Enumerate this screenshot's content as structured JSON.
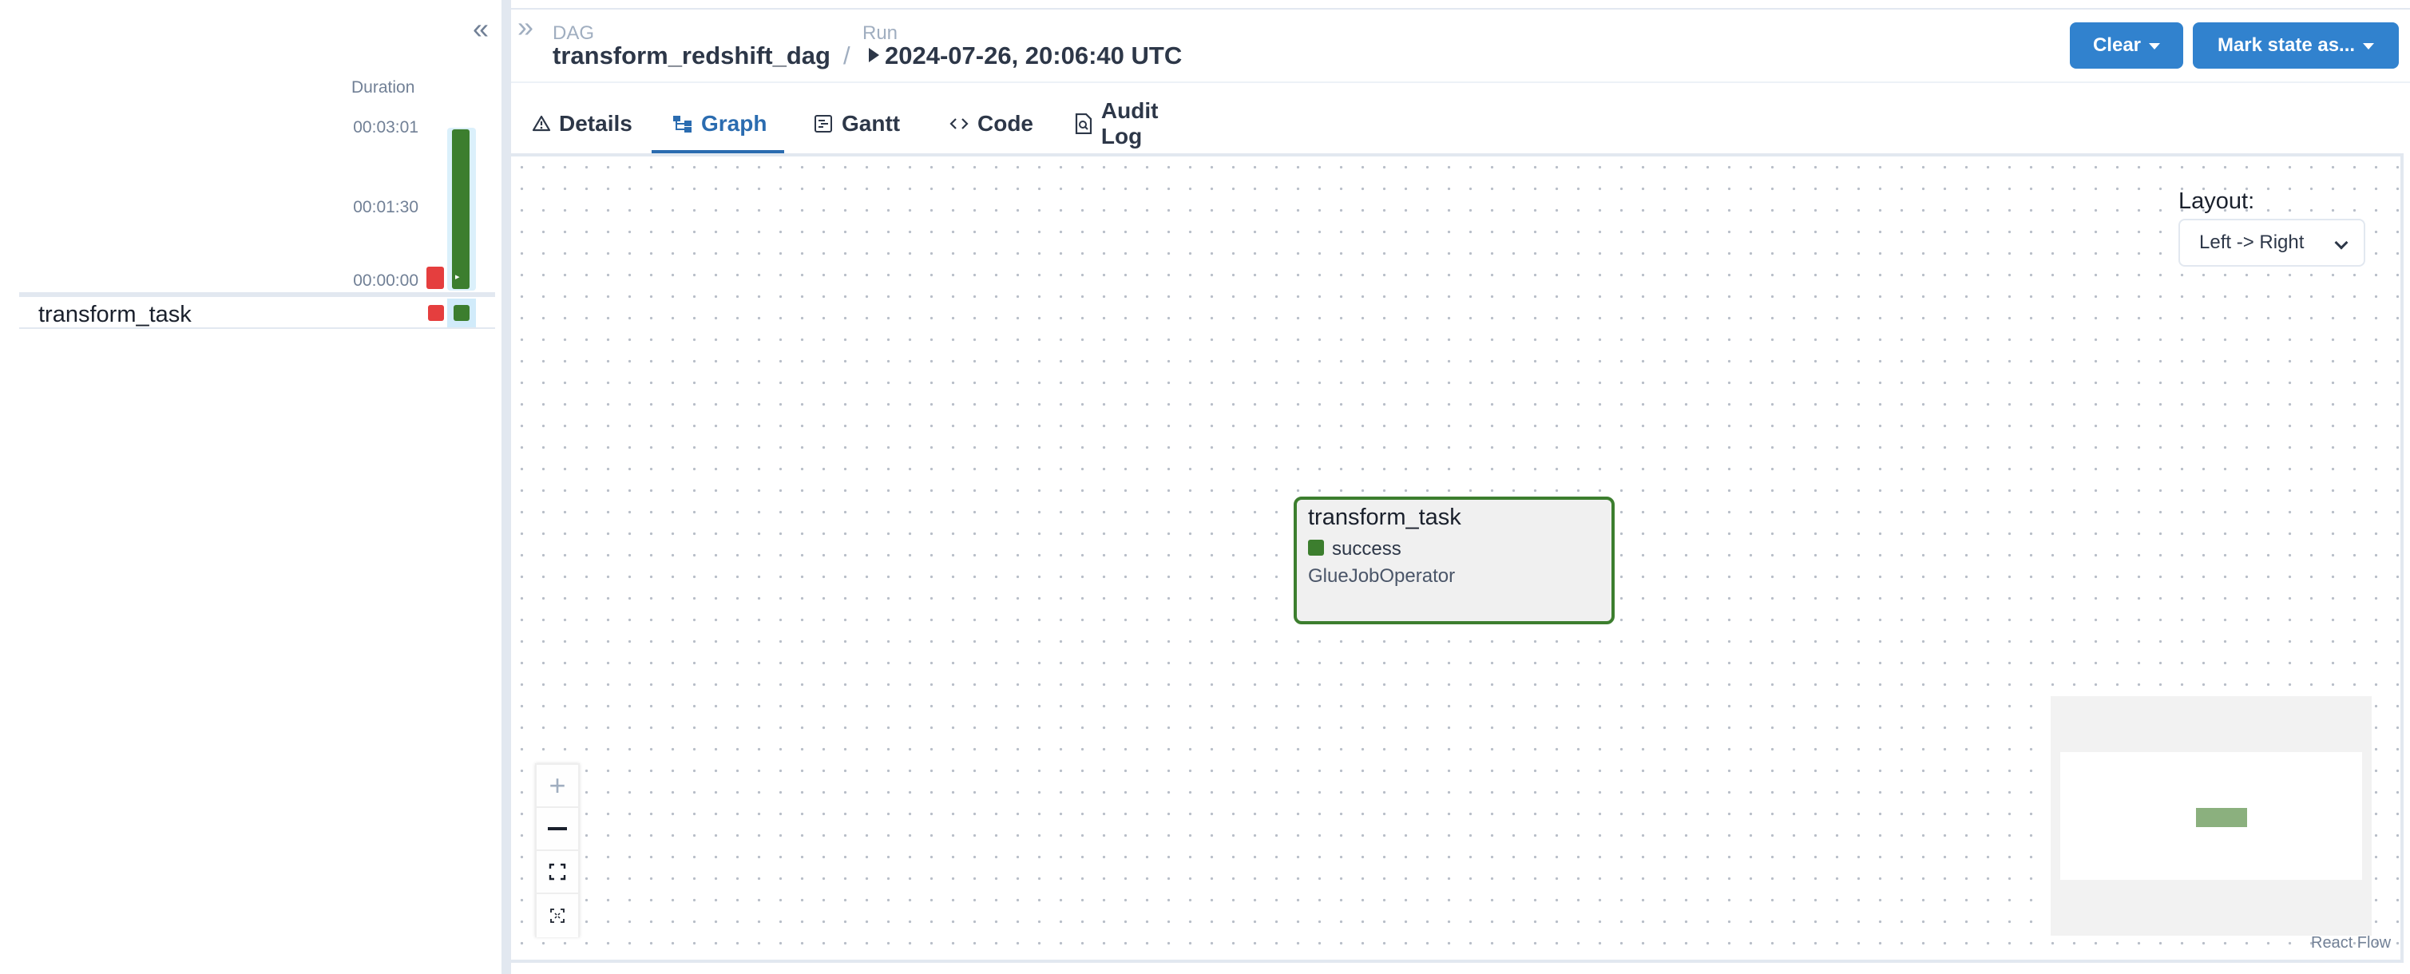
{
  "grid": {
    "duration_label": "Duration",
    "ticks": [
      "00:03:01",
      "00:01:30",
      "00:00:00"
    ],
    "run": {
      "state": "success",
      "duration": "00:03:01"
    },
    "tasks": [
      {
        "name": "transform_task",
        "state": "success"
      }
    ]
  },
  "header": {
    "dag_label": "DAG",
    "dag_id": "transform_redshift_dag",
    "separator": "/",
    "run_label": "Run",
    "run_value": "2024-07-26, 20:06:40 UTC",
    "clear_label": "Clear",
    "mark_state_label": "Mark state as..."
  },
  "tabs": [
    {
      "label": "Details",
      "icon": "alert-triangle-icon",
      "active": false
    },
    {
      "label": "Graph",
      "icon": "graph-icon",
      "active": true
    },
    {
      "label": "Gantt",
      "icon": "gantt-icon",
      "active": false
    },
    {
      "label": "Code",
      "icon": "code-icon",
      "active": false
    },
    {
      "label": "Audit Log",
      "icon": "file-search-icon",
      "active": false
    }
  ],
  "graph": {
    "layout_label": "Layout:",
    "layout_value": "Left -> Right",
    "node": {
      "name": "transform_task",
      "state": "success",
      "operator": "GlueJobOperator"
    },
    "attribution": "React Flow"
  },
  "colors": {
    "success": "#3c7e2e",
    "failed": "#e53e3e",
    "primary": "#3182ce",
    "active_tab": "#2b6cb0"
  }
}
